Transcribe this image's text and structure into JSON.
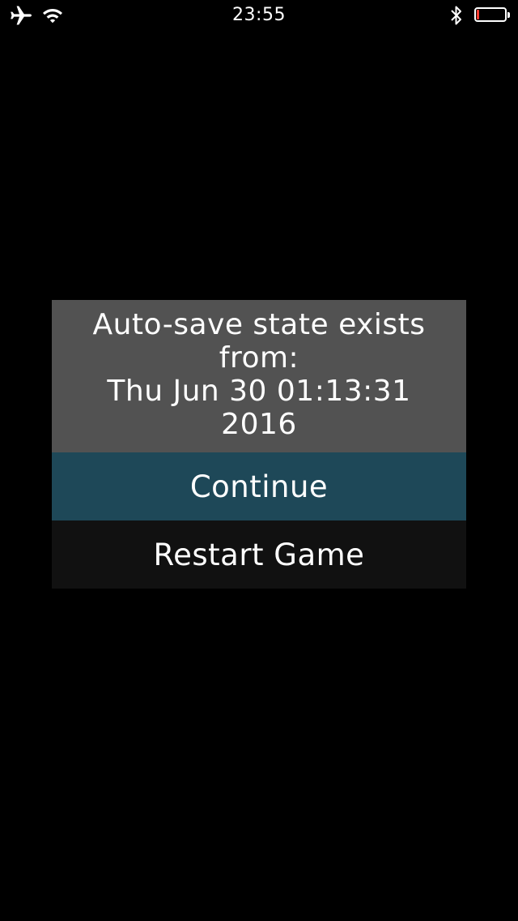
{
  "status_bar": {
    "time": "23:55",
    "icons": {
      "airplane": "airplane-mode-icon",
      "wifi": "wifi-icon",
      "bluetooth": "bluetooth-icon",
      "battery": "battery-icon"
    },
    "battery_level": 0.08,
    "battery_color": "#ff3b30"
  },
  "dialog": {
    "message": "Auto-save state exists\nfrom:\nThu Jun 30 01:13:31\n2016",
    "continue_label": "Continue",
    "restart_label": "Restart Game"
  },
  "colors": {
    "background": "#000000",
    "dialog_message_bg": "#525252",
    "continue_bg": "#1e4858",
    "restart_bg": "#111111",
    "text": "#ffffff"
  }
}
